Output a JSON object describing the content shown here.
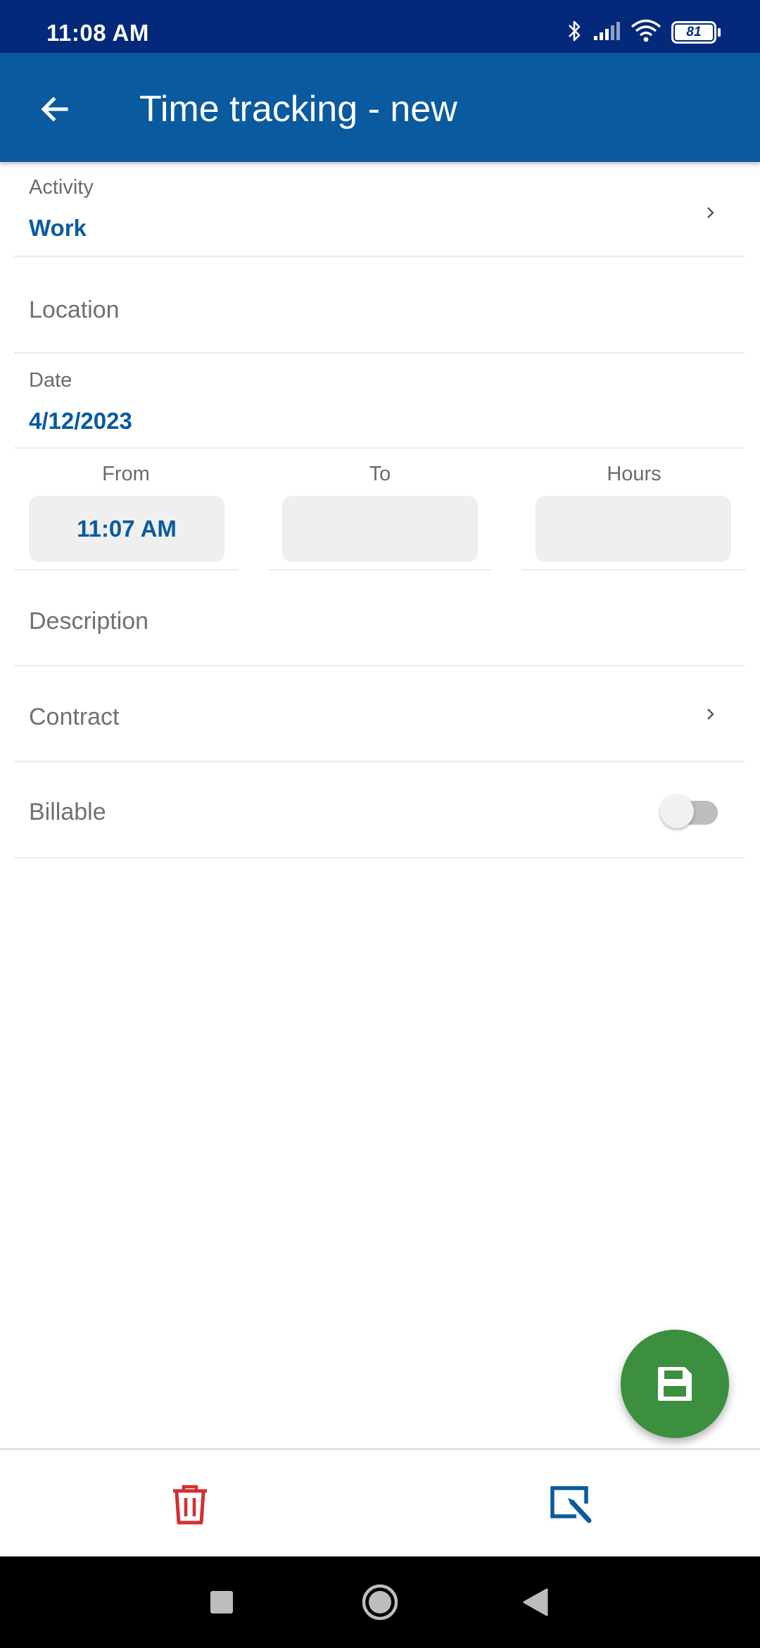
{
  "status_bar": {
    "time": "11:08 AM",
    "battery_level": "81",
    "icons": [
      "bluetooth-icon",
      "signal-icon",
      "wifi-icon",
      "battery-icon"
    ]
  },
  "app_bar": {
    "title": "Time tracking - new",
    "back_icon": "arrow-left-icon"
  },
  "form": {
    "activity": {
      "label": "Activity",
      "value": "Work"
    },
    "location": {
      "placeholder": "Location"
    },
    "date": {
      "label": "Date",
      "value": "4/12/2023"
    },
    "from": {
      "label": "From",
      "value": "11:07 AM"
    },
    "to": {
      "label": "To",
      "value": ""
    },
    "hours": {
      "label": "Hours",
      "value": ""
    },
    "description": {
      "placeholder": "Description"
    },
    "contract": {
      "placeholder": "Contract"
    },
    "billable": {
      "label": "Billable",
      "enabled": false
    }
  },
  "actions": {
    "save_icon": "save-icon",
    "delete_icon": "trash-icon",
    "edit_icon": "edit-icon"
  },
  "colors": {
    "status_bar": "#04287a",
    "app_bar": "#0a5aa0",
    "accent_text": "#0a5aa0",
    "fab": "#3b8f3e",
    "delete": "#d32f2f"
  }
}
